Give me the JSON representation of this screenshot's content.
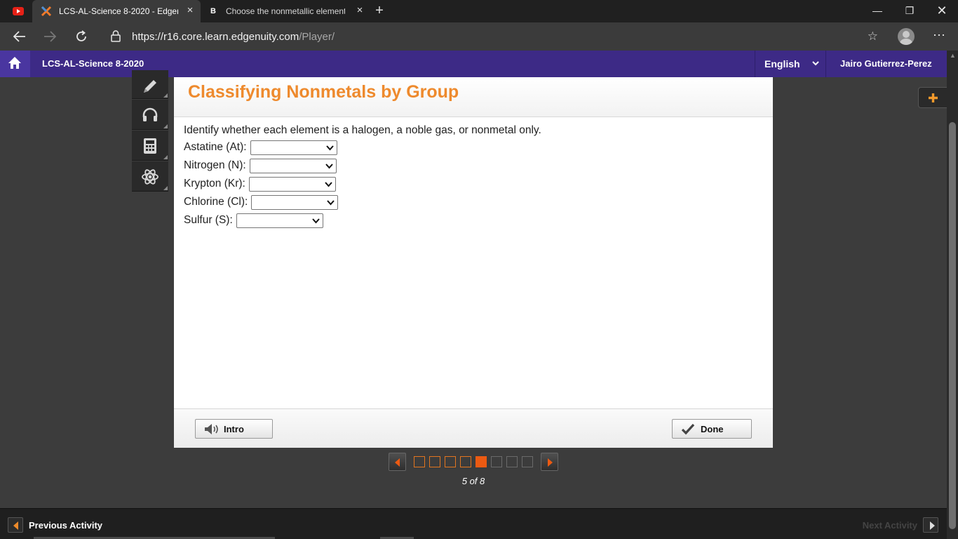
{
  "browser": {
    "tabs": [
      {
        "title": "LCS-AL-Science 8-2020 - Edgenuity",
        "active": true
      },
      {
        "title": "Choose the nonmetallic element",
        "active": false
      }
    ],
    "url_main": "https://r16.core.learn.edgenuity.com",
    "url_path": "/Player/",
    "icons": [
      "youtube-icon",
      "edgenuity-icon",
      "brainly-icon",
      "back-icon",
      "forward-icon",
      "refresh-icon",
      "lock-icon",
      "star-icon",
      "profile-icon",
      "more-icon"
    ]
  },
  "header": {
    "course": "LCS-AL-Science 8-2020",
    "language": "English",
    "user": "Jairo Gutierrez-Perez"
  },
  "tools": [
    "pencil-icon",
    "headphones-icon",
    "calculator-icon",
    "atom-icon"
  ],
  "activity": {
    "title": "Classifying Nonmetals by Group",
    "instructions": "Identify whether each element is a halogen, a noble gas, or nonmetal only.",
    "questions": [
      {
        "label": "Astatine (At):",
        "selected": ""
      },
      {
        "label": "Nitrogen (N):",
        "selected": ""
      },
      {
        "label": "Krypton (Kr):",
        "selected": ""
      },
      {
        "label": "Chlorine (Cl):",
        "selected": ""
      },
      {
        "label": "Sulfur (S):",
        "selected": ""
      }
    ],
    "intro_label": "Intro",
    "done_label": "Done"
  },
  "pager": {
    "current": 5,
    "total": 8,
    "label": "5 of 8"
  },
  "footer": {
    "previous_label": "Previous Activity",
    "next_label": "Next Activity"
  },
  "colors": {
    "header_purple": "#3d2a86",
    "title_orange": "#ee8a2d",
    "current_page": "#ec5a12"
  }
}
